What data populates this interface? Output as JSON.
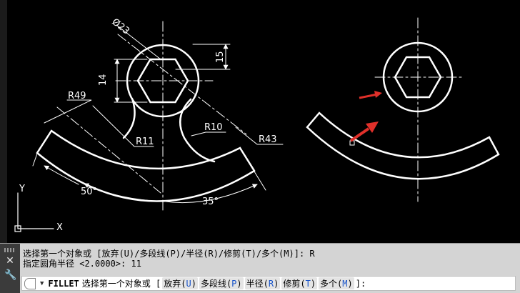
{
  "drawing": {
    "dim_phi23": "Ø23",
    "dim_15": "15",
    "dim_14": "14",
    "dim_r49": "R49",
    "dim_r11": "R11",
    "dim_r10": "R10",
    "dim_r43": "R43",
    "dim_50deg": "50°",
    "dim_35deg": "35°",
    "ucs_y": "Y",
    "ucs_x": "X"
  },
  "command": {
    "history": [
      "选择第一个对象或 [放弃(U)/多段线(P)/半径(R)/修剪(T)/多个(M)]: R",
      "指定圆角半径 <2.0000>: 11"
    ],
    "name": "FILLET",
    "prompt": "选择第一个对象或 [",
    "options": [
      {
        "label": "放弃(",
        "key": "U",
        "end": ")"
      },
      {
        "label": "多段线(",
        "key": "P",
        "end": ")"
      },
      {
        "label": "半径(",
        "key": "R",
        "end": ")"
      },
      {
        "label": "修剪(",
        "key": "T",
        "end": ")"
      },
      {
        "label": "多个(",
        "key": "M",
        "end": ")"
      }
    ],
    "suffix": "]:"
  },
  "colors": {
    "background": "#000000",
    "geometry": "#ffffff",
    "arrow": "#e0302a",
    "key": "#1a55c9"
  },
  "icons": {
    "close": "close-icon",
    "settings": "wrench-icon",
    "prompt": "command-prompt-icon",
    "dropdown": "chevron-down-icon"
  }
}
